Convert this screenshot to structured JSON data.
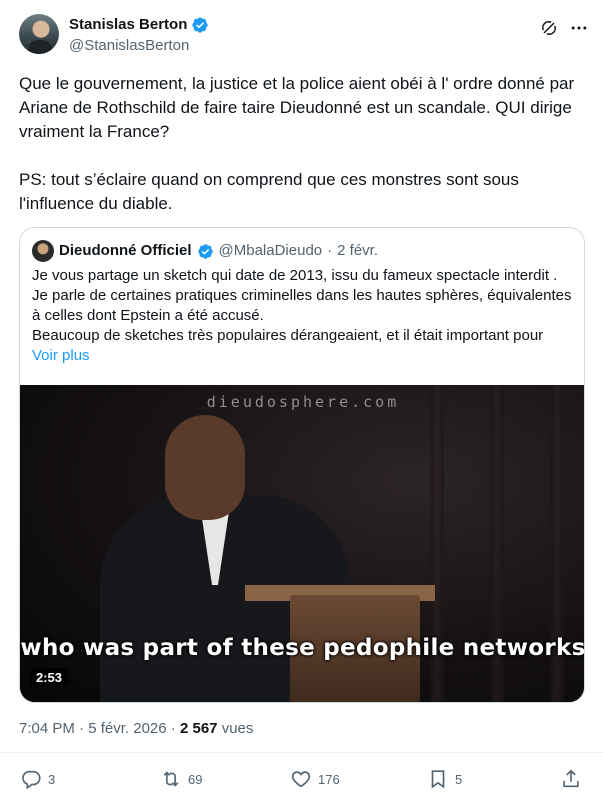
{
  "author": {
    "display_name": "Stanislas Berton",
    "handle": "@StanislasBerton"
  },
  "tweet": {
    "text": "Que le gouvernement, la justice et la police aient obéi à l' ordre donné par Ariane de Rothschild de faire taire Dieudonné est un scandale. QUI dirige vraiment la France?\n\nPS: tout s’éclaire quand on comprend que ces monstres sont sous l'influence du diable."
  },
  "quote": {
    "display_name": "Dieudonné Officiel",
    "handle": "@MbalaDieudo",
    "separator": "·",
    "date": "2 févr.",
    "lines": [
      "Je vous partage un sketch qui date de 2013, issu du fameux spectacle interdit .",
      "Je parle de certaines pratiques criminelles dans les hautes sphères, équivalentes à celles dont Epstein a été accusé.",
      "Beaucoup de sketches très populaires dérangeaient, et il était important pour"
    ],
    "show_more": "Voir plus",
    "video": {
      "watermark": "dieudosphere.com",
      "subtitle": "who was part of these pedophile networks",
      "duration": "2:53"
    }
  },
  "meta": {
    "time": "7:04 PM",
    "date": "5 févr. 2026",
    "separator": "·",
    "views_count": "2 567",
    "views_label": "vues"
  },
  "actions": {
    "replies": "3",
    "reposts": "69",
    "likes": "176",
    "bookmarks": "5"
  },
  "colors": {
    "accent": "#1d9bf0",
    "text": "#0f1419",
    "muted": "#536471",
    "border": "#cfd9de"
  }
}
